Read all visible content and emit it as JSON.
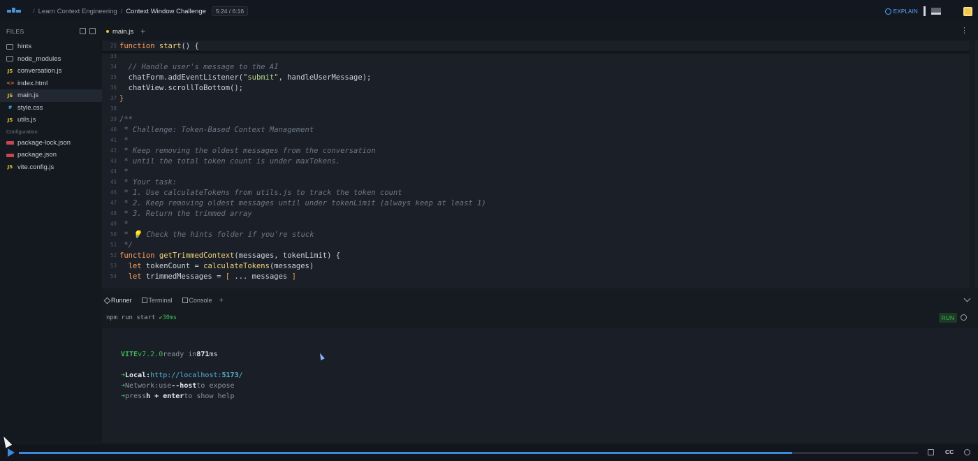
{
  "header": {
    "breadcrumb_sep": "/",
    "course": "Learn Context Engineering",
    "lesson": "Context Window Challenge",
    "time": "5:24 / 6:16",
    "explain": "EXPLAIN"
  },
  "sidebar": {
    "title": "FILES",
    "items": [
      {
        "label": "hints",
        "icon": "folder-icon"
      },
      {
        "label": "node_modules",
        "icon": "folder-icon"
      },
      {
        "label": "conversation.js",
        "icon": "js-file-icon"
      },
      {
        "label": "index.html",
        "icon": "html-file-icon"
      },
      {
        "label": "main.js",
        "icon": "js-file-icon"
      },
      {
        "label": "style.css",
        "icon": "css-file-icon"
      },
      {
        "label": "utils.js",
        "icon": "js-file-icon"
      }
    ],
    "config_label": "Configuration",
    "config_items": [
      {
        "label": "package-lock.json",
        "icon": "npm-file-icon"
      },
      {
        "label": "package.json",
        "icon": "npm-file-icon"
      },
      {
        "label": "vite.config.js",
        "icon": "js-file-icon"
      }
    ],
    "icon_labels": {
      "js": "JS",
      "html": "<>",
      "css": "#"
    }
  },
  "editor": {
    "tab": "main.js",
    "tab_add": "+",
    "more": "⋮",
    "sticky": {
      "ln": "25",
      "kw": "function",
      "fn": "start",
      "rest": "() {"
    },
    "lines": [
      {
        "ln": "33",
        "text": ""
      },
      {
        "ln": "34",
        "text": "  // Handle user's message to the AI"
      },
      {
        "ln": "35",
        "a": "  chatForm.addEventListener(",
        "s": "\"submit\"",
        "b": ", handleUserMessage);"
      },
      {
        "ln": "36",
        "text": "  chatView.scrollToBottom();"
      },
      {
        "ln": "37",
        "text": "}"
      },
      {
        "ln": "38",
        "text": ""
      },
      {
        "ln": "39",
        "text": "/**"
      },
      {
        "ln": "40",
        "text": " * Challenge: Token-Based Context Management"
      },
      {
        "ln": "41",
        "text": " *"
      },
      {
        "ln": "42",
        "text": " * Keep removing the oldest messages from the conversation"
      },
      {
        "ln": "43",
        "text": " * until the total token count is under maxTokens."
      },
      {
        "ln": "44",
        "text": " *"
      },
      {
        "ln": "45",
        "text": " * Your task:"
      },
      {
        "ln": "46",
        "text": " * 1. Use calculateTokens from utils.js to track the token count"
      },
      {
        "ln": "47",
        "text": " * 2. Keep removing oldest messages until under tokenLimit (always keep at least 1)"
      },
      {
        "ln": "48",
        "text": " * 3. Return the trimmed array"
      },
      {
        "ln": "49",
        "text": " *"
      },
      {
        "ln": "50",
        "text": " * 💡 Check the hints folder if you're stuck"
      },
      {
        "ln": "51",
        "text": " */"
      },
      {
        "ln": "52",
        "kw": "function",
        "fn": "getTrimmedContext",
        "rest": "(messages, tokenLimit) {"
      },
      {
        "ln": "53",
        "kw": "  let",
        "rest": " tokenCount = ",
        "fn": "calculateTokens",
        "rest2": "(messages)"
      },
      {
        "ln": "54",
        "kw": "  let",
        "rest": " trimmedMessages = ",
        "p": "[",
        "mid": " ... messages ",
        "p2": "]"
      }
    ]
  },
  "panel": {
    "tabs": [
      "Runner",
      "Terminal",
      "Console"
    ],
    "add": "+",
    "command": "npm run start",
    "status": "✔30ms",
    "run": "RUN"
  },
  "terminal": {
    "vite": "VITE",
    "version": "v7.2.0",
    "ready": "ready in",
    "ms_value": "871",
    "ms": "ms",
    "arrow": "➜",
    "local_label": "Local:",
    "local_url": "http://localhost:",
    "local_port": "5173",
    "local_slash": "/",
    "network_label": "Network:",
    "network_use": "use",
    "network_host": "--host",
    "network_rest": "to expose",
    "help_press": "press",
    "help_keys": "h + enter",
    "help_rest": "to show help"
  },
  "video": {
    "progress": 0.86,
    "cc": "CC"
  },
  "colors": {
    "accent": "#3b8ae0",
    "success": "#3fb950",
    "keyword": "#ff9d5c",
    "function": "#f2d17a",
    "string": "#b6d68e",
    "comment": "#6c7684"
  }
}
